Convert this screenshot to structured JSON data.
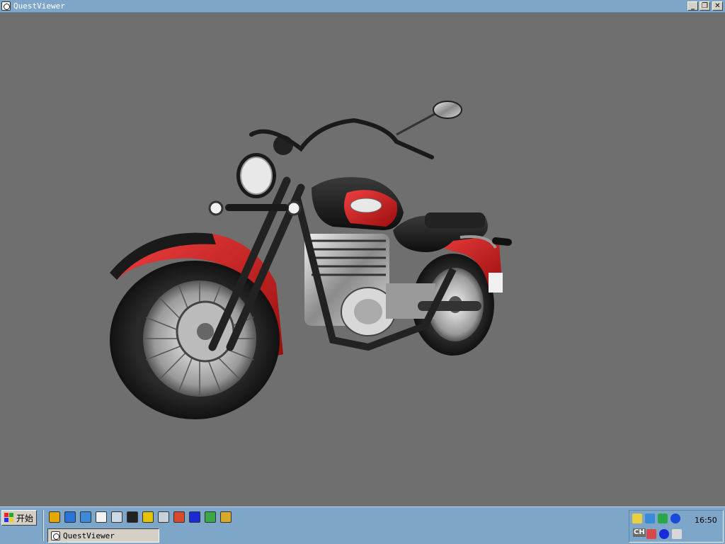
{
  "window": {
    "title": "QuestViewer",
    "controls": {
      "minimize": "_",
      "restore": "❐",
      "close": "✕"
    }
  },
  "viewport": {
    "background": "#6f6f6f",
    "scene": "motorcycle-3d-model"
  },
  "taskbar": {
    "start_label": "开始",
    "quick_launch": [
      {
        "name": "media-player-icon",
        "color": "#e6a800"
      },
      {
        "name": "internet-explorer-icon",
        "color": "#2a74d8"
      },
      {
        "name": "outlook-express-icon",
        "color": "#3d8bd8"
      },
      {
        "name": "notepad-icon",
        "color": "#f2f2f2"
      },
      {
        "name": "desktop-icon",
        "color": "#cfd8e6"
      },
      {
        "name": "browser-icon",
        "color": "#222222"
      },
      {
        "name": "paint-icon",
        "color": "#e6c200"
      },
      {
        "name": "computer-icon",
        "color": "#c8d0d8"
      },
      {
        "name": "tool-icon",
        "color": "#d84a2a"
      },
      {
        "name": "eye-icon",
        "color": "#1a2ad8"
      },
      {
        "name": "movie-icon",
        "color": "#3aa848"
      },
      {
        "name": "grid-icon",
        "color": "#d8a82a"
      }
    ],
    "task_button_label": "QuestViewer",
    "tray": {
      "clock": "16:50",
      "input_indicator": "CH",
      "icons": [
        "volume-icon",
        "network-icon",
        "messenger-icon",
        "antivirus-icon",
        "shield-icon",
        "eye-icon",
        "wrench-icon"
      ]
    }
  }
}
